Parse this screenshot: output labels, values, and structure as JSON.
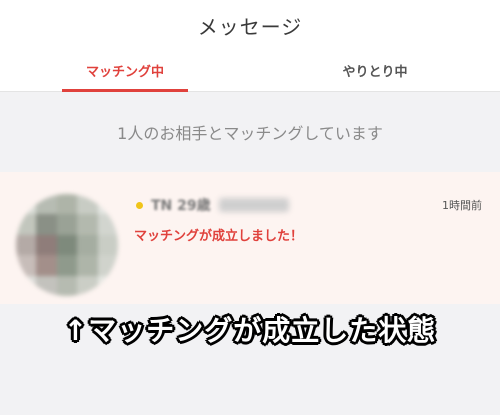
{
  "header": {
    "title": "メッセージ"
  },
  "tabs": [
    {
      "label": "マッチング中",
      "active": true
    },
    {
      "label": "やりとり中",
      "active": false
    }
  ],
  "match_count_text": "1人のお相手とマッチングしています",
  "match": {
    "name": "TN 29歳",
    "time": "1時間前",
    "message": "マッチングが成立しました！",
    "status_color": "#f0c419"
  },
  "caption": "↑マッチングが成立した状態",
  "colors": {
    "accent": "#e0413c",
    "highlight_bg": "#fdf4f1"
  }
}
